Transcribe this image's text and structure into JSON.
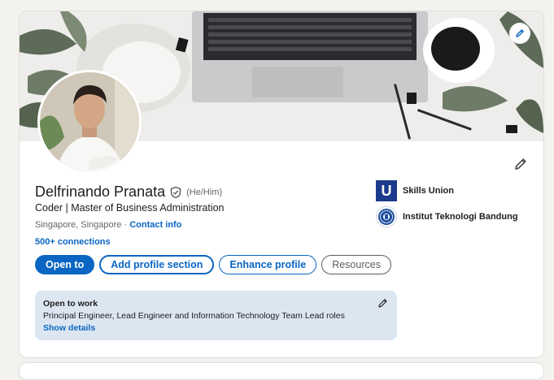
{
  "profile": {
    "name": "Delfrinando Pranata",
    "pronouns": "(He/Him)",
    "headline": "Coder | Master of Business Administration",
    "location": "Singapore, Singapore",
    "location_separator": "·",
    "contact_info_label": "Contact info",
    "connections_label": "500+ connections",
    "verified_icon": "shield-check-icon"
  },
  "actions": {
    "open_to": "Open to",
    "add_profile_section": "Add profile section",
    "enhance_profile": "Enhance profile",
    "resources": "Resources"
  },
  "companies": [
    {
      "name": "Skills Union",
      "logo": "U"
    },
    {
      "name": "Institut Teknologi Bandung",
      "logo": "itb-seal"
    }
  ],
  "open_to_work": {
    "title": "Open to work",
    "roles": "Principal Engineer, Lead Engineer and Information Technology Team Lead roles",
    "show_details": "Show details"
  },
  "icons": {
    "banner_edit": "pencil-icon",
    "profile_edit": "pencil-icon",
    "open_to_work_edit": "pencil-icon"
  },
  "colors": {
    "accent": "#0a66c2",
    "open_to_work_bg": "#dce6f1",
    "skills_union_logo": "#1c3a8c"
  }
}
